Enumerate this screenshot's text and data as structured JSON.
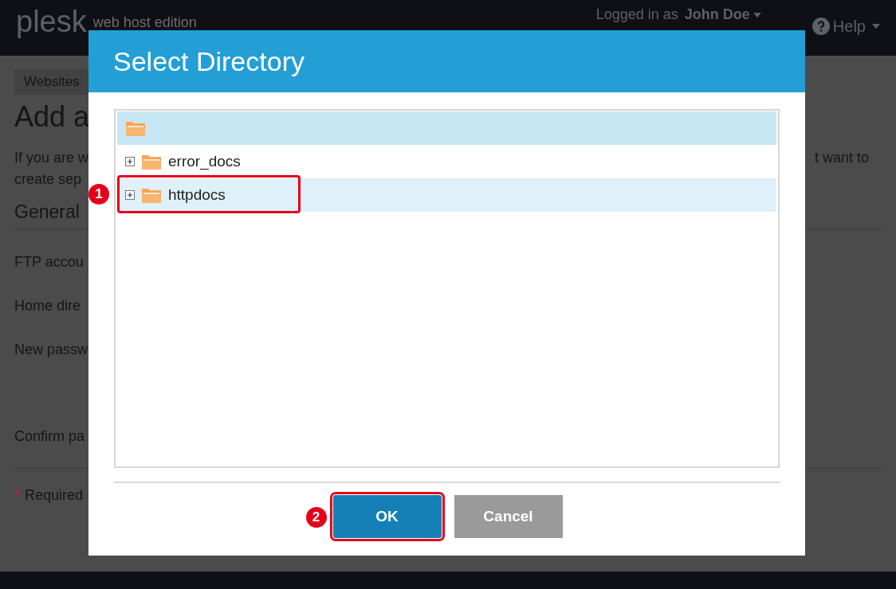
{
  "header": {
    "logo": "plesk",
    "edition": "web host edition",
    "logged_in_label": "Logged in as",
    "user": "John Doe",
    "help": "Help"
  },
  "page": {
    "tab": "Websites",
    "title": "Add a",
    "intro_left": [
      "If you are w",
      "create sep"
    ],
    "intro_right": "t want to",
    "section": "General",
    "fields": [
      "FTP accou",
      "Home dire",
      "New passw",
      "Confirm pa"
    ],
    "required_mark": "*",
    "required": "Required"
  },
  "dialog": {
    "title": "Select Directory",
    "tree": [
      {
        "expandable": false,
        "selected": true,
        "hovered": false
      },
      {
        "label": "error_docs",
        "expandable": true,
        "selected": false,
        "hovered": false
      },
      {
        "label": "httpdocs",
        "expandable": true,
        "selected": false,
        "hovered": true,
        "annotation": "1"
      }
    ],
    "buttons": [
      {
        "label": "OK",
        "kind": "primary",
        "annotation": "2"
      },
      {
        "label": "Cancel",
        "kind": "secondary"
      }
    ]
  }
}
